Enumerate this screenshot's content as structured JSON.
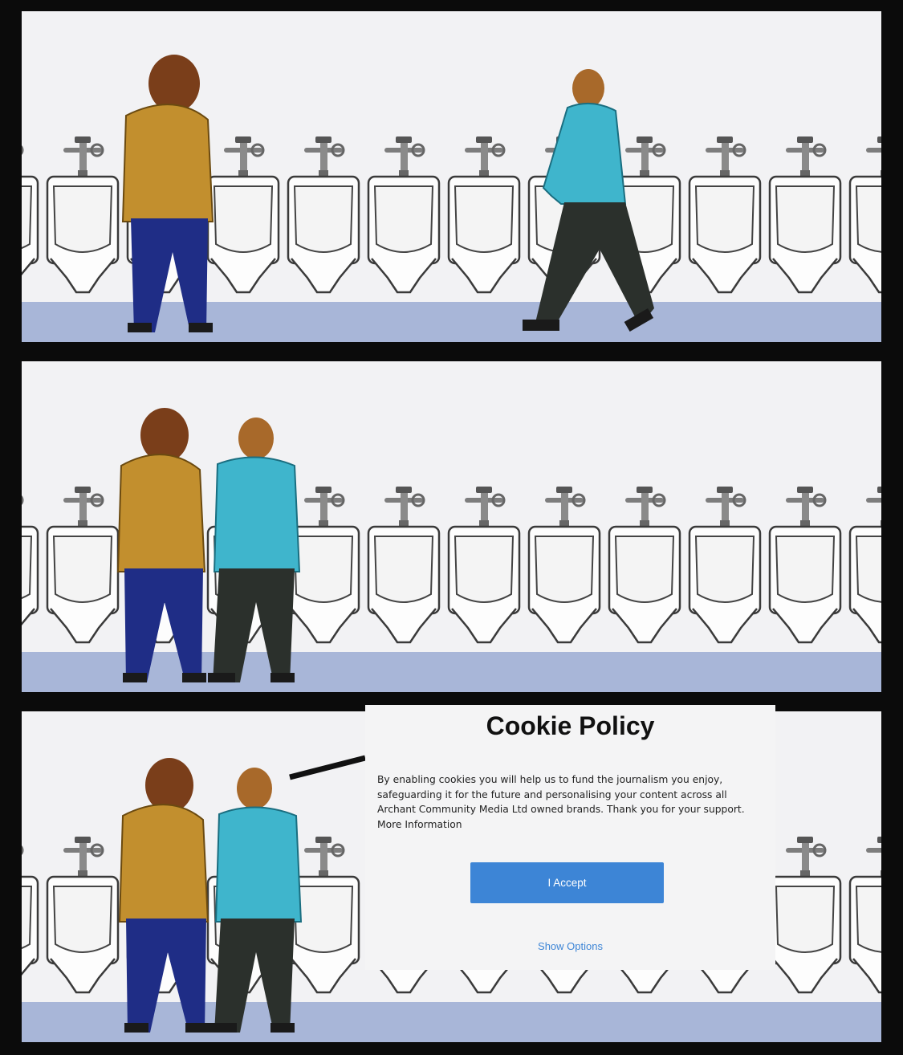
{
  "comic": {
    "panels": [
      {
        "scene": "first-man-at-urinal-second-man-walking-in"
      },
      {
        "scene": "second-man-at-adjacent-urinal"
      },
      {
        "scene": "second-man-looks-over"
      }
    ],
    "colors": {
      "background": "#0b0b0b",
      "wall": "#f2f2f4",
      "floor": "#a8b6d8",
      "hoodie": "#c28f2e",
      "jeans": "#1f2d86",
      "shirt": "#3fb5cc",
      "trousers": "#2b302c",
      "hair": "#7a3e1a"
    }
  },
  "cookie_dialog": {
    "title": "Cookie Policy",
    "body_lines": [
      "By enabling cookies you will help us to fund the journalism you enjoy,",
      "safeguarding it for the future and personalising your content across all",
      "Archant Community Media Ltd owned brands. Thank you for your support."
    ],
    "more_info_label": "More Information",
    "accept_label": "I Accept",
    "options_label": "Show Options",
    "colors": {
      "button": "#3d85d6",
      "link": "#3d85d6",
      "dialog": "#f4f4f5"
    }
  }
}
